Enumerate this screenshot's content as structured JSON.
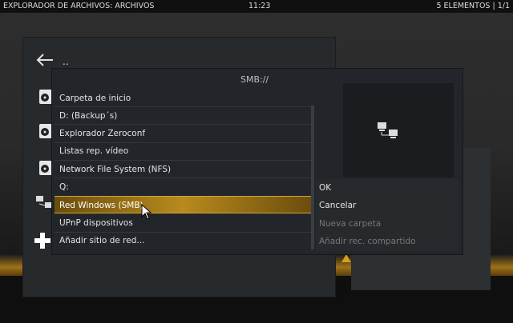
{
  "topbar": {
    "title": "EXPLORADOR DE ARCHIVOS: ARCHIVOS",
    "clock": "11:23",
    "count": "5 ELEMENTOS | 1/1"
  },
  "browser": {
    "parent_label": ".."
  },
  "dialog": {
    "title": "SMB://",
    "items": [
      {
        "label": "Carpeta de inicio"
      },
      {
        "label": "D: (Backup´s)"
      },
      {
        "label": "Explorador Zeroconf"
      },
      {
        "label": "Listas rep. vídeo"
      },
      {
        "label": "Network File System (NFS)"
      },
      {
        "label": "Q:"
      },
      {
        "label": "Red Windows (SMB)"
      },
      {
        "label": "UPnP dispositivos"
      },
      {
        "label": "Añadir sitio de red..."
      }
    ],
    "selected_index": 6,
    "buttons": {
      "ok": "OK",
      "cancel": "Cancelar",
      "new_folder": "Nueva carpeta",
      "add_share": "Añadir rec. compartido"
    }
  },
  "colors": {
    "accent": "#b88a1e",
    "panel": "#22262a"
  }
}
